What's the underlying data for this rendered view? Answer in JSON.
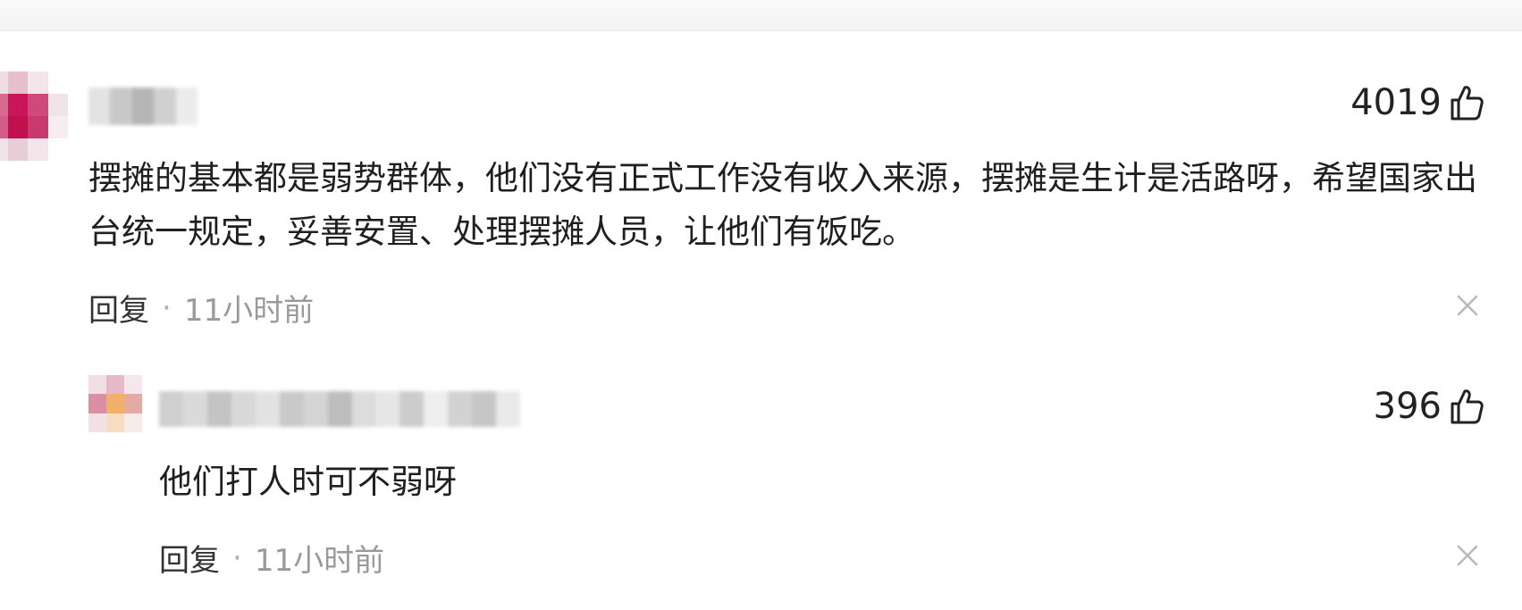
{
  "comments": [
    {
      "likes": "4019",
      "text": "摆摊的基本都是弱势群体，他们没有正式工作没有收入来源，摆摊是生计是活路呀，希望国家出台统一规定，妥善安置、处理摆摊人员，让他们有饭吃。",
      "reply_label": "回复",
      "separator": "·",
      "time": "11小时前",
      "avatar_colors": [
        "#f0dde3",
        "#e8bfcc",
        "#f3e6ea",
        "#ffffff",
        "#d86a8f",
        "#c9155a",
        "#cf4a7a",
        "#f1e4e8",
        "#d35d86",
        "#c0104e",
        "#c73a6b",
        "#f7ecef",
        "#efe4e7",
        "#e6cdd6",
        "#f2e6ea",
        "#ffffff"
      ],
      "name_colors": [
        "#e3e3e3",
        "#c8c8c8",
        "#b5b5b5",
        "#d0d0d0",
        "#ececec"
      ],
      "icons": {
        "like": "thumbs-up-icon",
        "close": "close-icon"
      }
    },
    {
      "likes": "396",
      "text": "他们打人时可不弱呀",
      "reply_label": "回复",
      "separator": "·",
      "time": "11小时前",
      "avatar_colors": [
        "#f1dfe4",
        "#e5b9c6",
        "#f4e8ec",
        "#dc8ea2",
        "#f0b06a",
        "#e7a9a4",
        "#f3e1e5",
        "#f7dcc3",
        "#f6ece9"
      ],
      "name_colors": [
        "#cfcfcf",
        "#dadada",
        "#c4c4c4",
        "#d8d8d8",
        "#e2e2e2",
        "#c9c9c9",
        "#d4d4d4",
        "#bdbdbd",
        "#dcdcdc",
        "#e6e6e6",
        "#cccccc",
        "#eeeeee",
        "#d2d2d2",
        "#c6c6c6",
        "#e9e9e9"
      ],
      "icons": {
        "like": "thumbs-up-icon",
        "close": "close-icon"
      }
    }
  ]
}
